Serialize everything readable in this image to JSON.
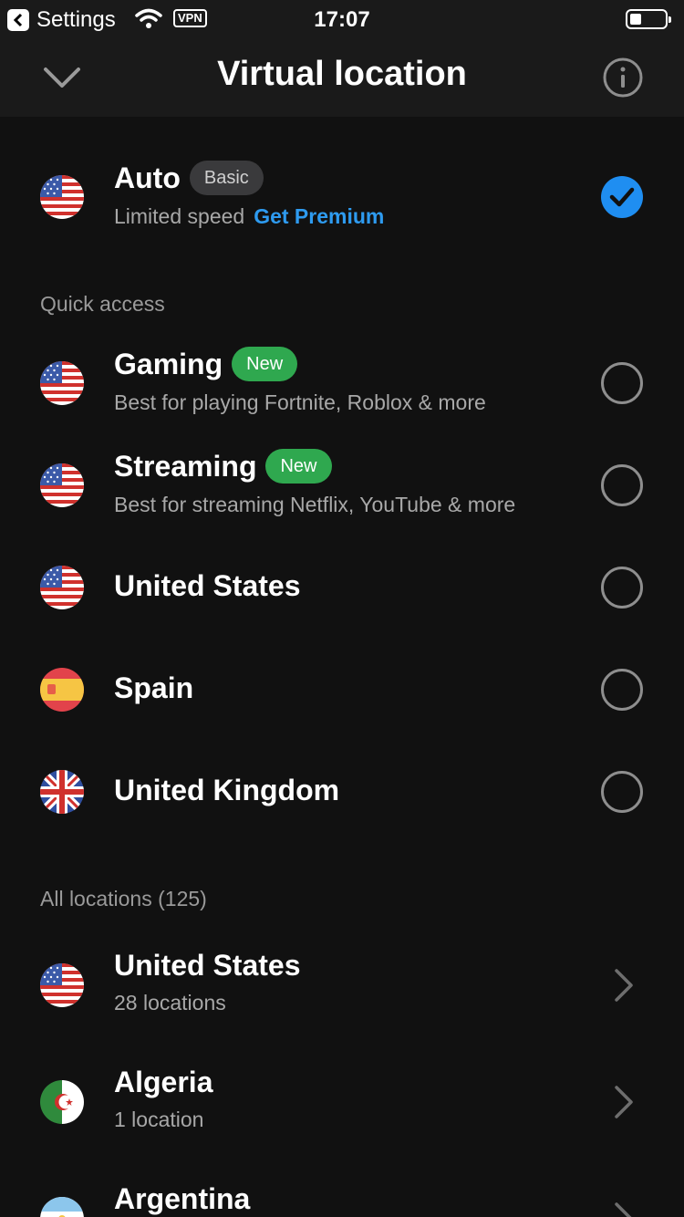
{
  "status_bar": {
    "back_app": "Settings",
    "vpn": "VPN",
    "time": "17:07"
  },
  "header": {
    "title": "Virtual location"
  },
  "auto": {
    "title": "Auto",
    "badge": "Basic",
    "subtitle": "Limited speed",
    "link": "Get Premium",
    "selected": true
  },
  "quick_access": {
    "label": "Quick access",
    "items": [
      {
        "title": "Gaming",
        "badge": "New",
        "subtitle": "Best for playing Fortnite, Roblox & more",
        "flag": "us"
      },
      {
        "title": "Streaming",
        "badge": "New",
        "subtitle": "Best for streaming Netflix, YouTube & more",
        "flag": "us"
      },
      {
        "title": "United States",
        "flag": "us"
      },
      {
        "title": "Spain",
        "flag": "es"
      },
      {
        "title": "United Kingdom",
        "flag": "gb"
      }
    ]
  },
  "all_locations": {
    "label": "All locations (125)",
    "items": [
      {
        "title": "United States",
        "subtitle": "28 locations",
        "flag": "us"
      },
      {
        "title": "Algeria",
        "subtitle": "1 location",
        "flag": "dz"
      },
      {
        "title": "Argentina",
        "flag": "ar"
      }
    ]
  },
  "colors": {
    "background": "#111111",
    "header": "#1a1a1a",
    "accent": "#1f8ef1",
    "link": "#2e9bf0",
    "new_badge": "#2fa84f"
  }
}
